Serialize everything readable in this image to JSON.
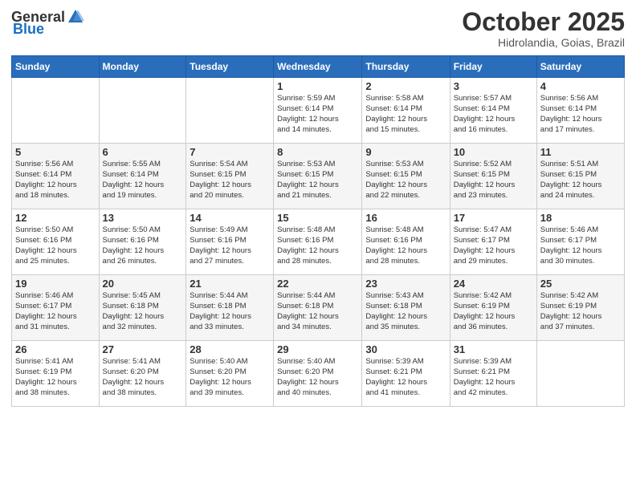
{
  "logo": {
    "general": "General",
    "blue": "Blue"
  },
  "header": {
    "month": "October 2025",
    "location": "Hidrolandia, Goias, Brazil"
  },
  "weekdays": [
    "Sunday",
    "Monday",
    "Tuesday",
    "Wednesday",
    "Thursday",
    "Friday",
    "Saturday"
  ],
  "weeks": [
    [
      {
        "day": "",
        "info": ""
      },
      {
        "day": "",
        "info": ""
      },
      {
        "day": "",
        "info": ""
      },
      {
        "day": "1",
        "sunrise": "5:59 AM",
        "sunset": "6:14 PM",
        "daylight": "12 hours and 14 minutes."
      },
      {
        "day": "2",
        "sunrise": "5:58 AM",
        "sunset": "6:14 PM",
        "daylight": "12 hours and 15 minutes."
      },
      {
        "day": "3",
        "sunrise": "5:57 AM",
        "sunset": "6:14 PM",
        "daylight": "12 hours and 16 minutes."
      },
      {
        "day": "4",
        "sunrise": "5:56 AM",
        "sunset": "6:14 PM",
        "daylight": "12 hours and 17 minutes."
      }
    ],
    [
      {
        "day": "5",
        "sunrise": "5:56 AM",
        "sunset": "6:14 PM",
        "daylight": "12 hours and 18 minutes."
      },
      {
        "day": "6",
        "sunrise": "5:55 AM",
        "sunset": "6:14 PM",
        "daylight": "12 hours and 19 minutes."
      },
      {
        "day": "7",
        "sunrise": "5:54 AM",
        "sunset": "6:15 PM",
        "daylight": "12 hours and 20 minutes."
      },
      {
        "day": "8",
        "sunrise": "5:53 AM",
        "sunset": "6:15 PM",
        "daylight": "12 hours and 21 minutes."
      },
      {
        "day": "9",
        "sunrise": "5:53 AM",
        "sunset": "6:15 PM",
        "daylight": "12 hours and 22 minutes."
      },
      {
        "day": "10",
        "sunrise": "5:52 AM",
        "sunset": "6:15 PM",
        "daylight": "12 hours and 23 minutes."
      },
      {
        "day": "11",
        "sunrise": "5:51 AM",
        "sunset": "6:15 PM",
        "daylight": "12 hours and 24 minutes."
      }
    ],
    [
      {
        "day": "12",
        "sunrise": "5:50 AM",
        "sunset": "6:16 PM",
        "daylight": "12 hours and 25 minutes."
      },
      {
        "day": "13",
        "sunrise": "5:50 AM",
        "sunset": "6:16 PM",
        "daylight": "12 hours and 26 minutes."
      },
      {
        "day": "14",
        "sunrise": "5:49 AM",
        "sunset": "6:16 PM",
        "daylight": "12 hours and 27 minutes."
      },
      {
        "day": "15",
        "sunrise": "5:48 AM",
        "sunset": "6:16 PM",
        "daylight": "12 hours and 28 minutes."
      },
      {
        "day": "16",
        "sunrise": "5:48 AM",
        "sunset": "6:16 PM",
        "daylight": "12 hours and 28 minutes."
      },
      {
        "day": "17",
        "sunrise": "5:47 AM",
        "sunset": "6:17 PM",
        "daylight": "12 hours and 29 minutes."
      },
      {
        "day": "18",
        "sunrise": "5:46 AM",
        "sunset": "6:17 PM",
        "daylight": "12 hours and 30 minutes."
      }
    ],
    [
      {
        "day": "19",
        "sunrise": "5:46 AM",
        "sunset": "6:17 PM",
        "daylight": "12 hours and 31 minutes."
      },
      {
        "day": "20",
        "sunrise": "5:45 AM",
        "sunset": "6:18 PM",
        "daylight": "12 hours and 32 minutes."
      },
      {
        "day": "21",
        "sunrise": "5:44 AM",
        "sunset": "6:18 PM",
        "daylight": "12 hours and 33 minutes."
      },
      {
        "day": "22",
        "sunrise": "5:44 AM",
        "sunset": "6:18 PM",
        "daylight": "12 hours and 34 minutes."
      },
      {
        "day": "23",
        "sunrise": "5:43 AM",
        "sunset": "6:18 PM",
        "daylight": "12 hours and 35 minutes."
      },
      {
        "day": "24",
        "sunrise": "5:42 AM",
        "sunset": "6:19 PM",
        "daylight": "12 hours and 36 minutes."
      },
      {
        "day": "25",
        "sunrise": "5:42 AM",
        "sunset": "6:19 PM",
        "daylight": "12 hours and 37 minutes."
      }
    ],
    [
      {
        "day": "26",
        "sunrise": "5:41 AM",
        "sunset": "6:19 PM",
        "daylight": "12 hours and 38 minutes."
      },
      {
        "day": "27",
        "sunrise": "5:41 AM",
        "sunset": "6:20 PM",
        "daylight": "12 hours and 38 minutes."
      },
      {
        "day": "28",
        "sunrise": "5:40 AM",
        "sunset": "6:20 PM",
        "daylight": "12 hours and 39 minutes."
      },
      {
        "day": "29",
        "sunrise": "5:40 AM",
        "sunset": "6:20 PM",
        "daylight": "12 hours and 40 minutes."
      },
      {
        "day": "30",
        "sunrise": "5:39 AM",
        "sunset": "6:21 PM",
        "daylight": "12 hours and 41 minutes."
      },
      {
        "day": "31",
        "sunrise": "5:39 AM",
        "sunset": "6:21 PM",
        "daylight": "12 hours and 42 minutes."
      },
      {
        "day": "",
        "info": ""
      }
    ]
  ],
  "labels": {
    "sunrise": "Sunrise:",
    "sunset": "Sunset:",
    "daylight": "Daylight:"
  }
}
